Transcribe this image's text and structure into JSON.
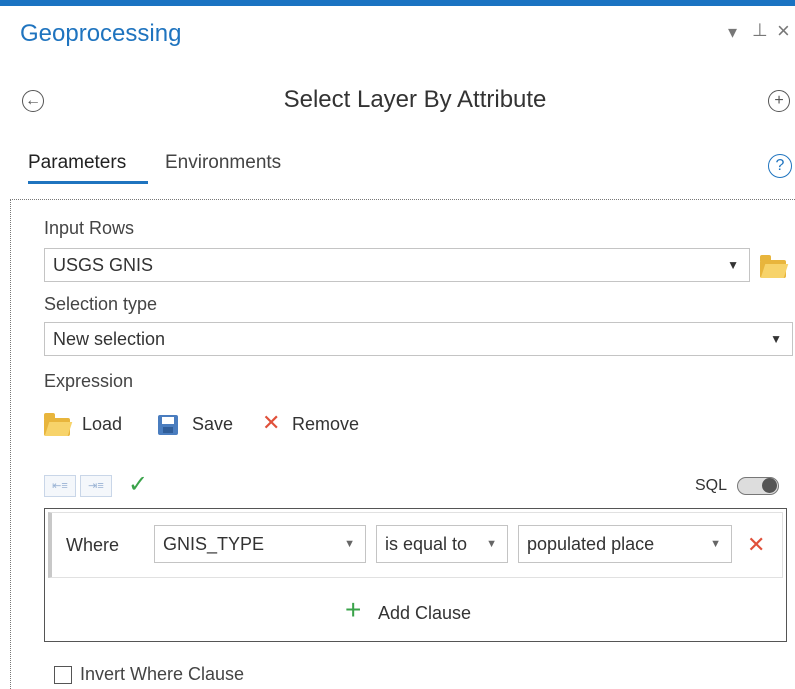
{
  "pane": {
    "title": "Geoprocessing",
    "controls": {
      "menu": "▾",
      "pin": "⊥",
      "close": "×"
    }
  },
  "tool": {
    "back": "←",
    "title": "Select Layer By Attribute",
    "add": "+"
  },
  "tabs": [
    {
      "label": "Parameters",
      "active": true
    },
    {
      "label": "Environments",
      "active": false
    }
  ],
  "help": "?",
  "input_rows": {
    "label": "Input Rows",
    "value": "USGS GNIS"
  },
  "selection_type": {
    "label": "Selection type",
    "value": "New selection"
  },
  "expression": {
    "label": "Expression",
    "load": "Load",
    "save": "Save",
    "remove": "Remove",
    "sql_label": "SQL",
    "sql_enabled": false
  },
  "clause": {
    "where": "Where",
    "field": "GNIS_TYPE",
    "operator": "is equal to",
    "value": "populated place"
  },
  "add_clause": "Add Clause",
  "invert": {
    "label": "Invert Where Clause",
    "checked": false
  },
  "colors": {
    "accent": "#1f74bf",
    "remove": "#e0503a",
    "valid": "#3aa34a",
    "folder": "#e8b53c"
  }
}
